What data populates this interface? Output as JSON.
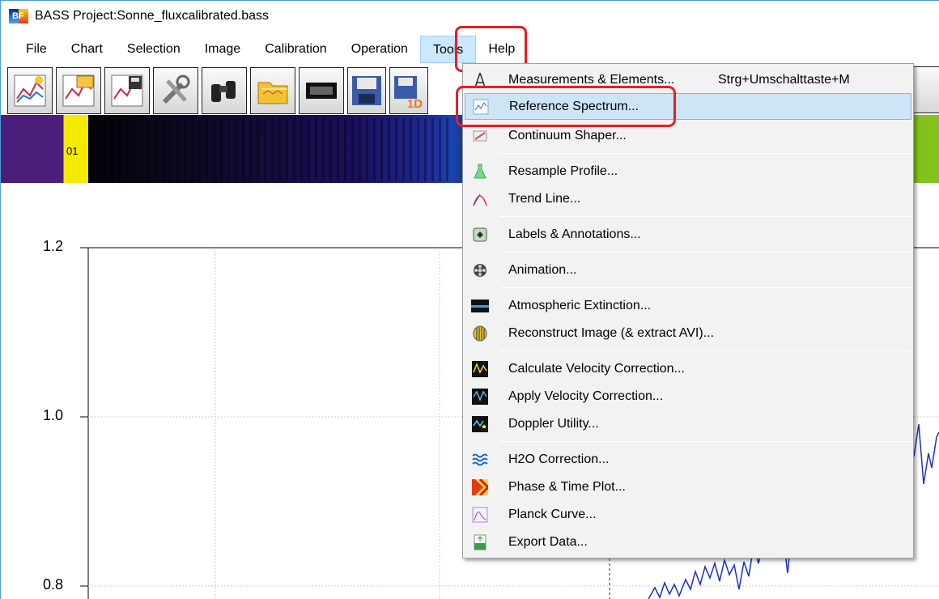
{
  "window": {
    "title": "BASS Project:Sonne_fluxcalibrated.bass"
  },
  "menubar": {
    "items": [
      {
        "label": "File"
      },
      {
        "label": "Chart"
      },
      {
        "label": "Selection"
      },
      {
        "label": "Image"
      },
      {
        "label": "Calibration"
      },
      {
        "label": "Operation"
      },
      {
        "label": "Tools",
        "active": true
      },
      {
        "label": "Help"
      }
    ]
  },
  "toolbar": {
    "buttons": [
      "new-chart-icon",
      "open-chart-icon",
      "save-chart-icon",
      "tools-icon",
      "binoculars-icon",
      "open-folder-icon",
      "camera-strip-icon",
      "save-disk-icon",
      "save-1d-icon"
    ],
    "save_1d_badge": "1D"
  },
  "spectrum_strip": {
    "label": "01"
  },
  "chart": {
    "y_ticks": [
      "1.2",
      "1.0",
      "0.8"
    ],
    "line_color": "#1a2fd0"
  },
  "tools_menu": {
    "items": [
      {
        "label": "Measurements & Elements...",
        "shortcut": "Strg+Umschalttaste+M",
        "icon": "measure-compass-icon"
      },
      {
        "label": "Reference Spectrum...",
        "icon": "reference-spectrum-icon",
        "selected": true
      },
      {
        "label": "Continuum Shaper...",
        "icon": "continuum-shaper-icon"
      },
      {
        "label": "Resample Profile...",
        "icon": "flask-icon"
      },
      {
        "label": "Trend Line...",
        "icon": "trend-line-icon"
      },
      {
        "label": "Labels & Annotations...",
        "icon": "labels-icon"
      },
      {
        "label": "Animation...",
        "icon": "film-reel-icon"
      },
      {
        "label": "Atmospheric Extinction...",
        "icon": "extinction-icon"
      },
      {
        "label": "Reconstruct Image (& extract AVI)...",
        "icon": "reconstruct-image-icon"
      },
      {
        "label": "Calculate Velocity Correction...",
        "icon": "calc-velocity-icon"
      },
      {
        "label": "Apply Velocity Correction...",
        "icon": "apply-velocity-icon"
      },
      {
        "label": "Doppler Utility...",
        "icon": "doppler-icon"
      },
      {
        "label": "H2O Correction...",
        "icon": "water-waves-icon"
      },
      {
        "label": "Phase & Time Plot...",
        "icon": "phase-plot-icon"
      },
      {
        "label": "Planck Curve...",
        "icon": "planck-curve-icon"
      },
      {
        "label": "Export Data...",
        "icon": "export-data-icon"
      }
    ]
  }
}
